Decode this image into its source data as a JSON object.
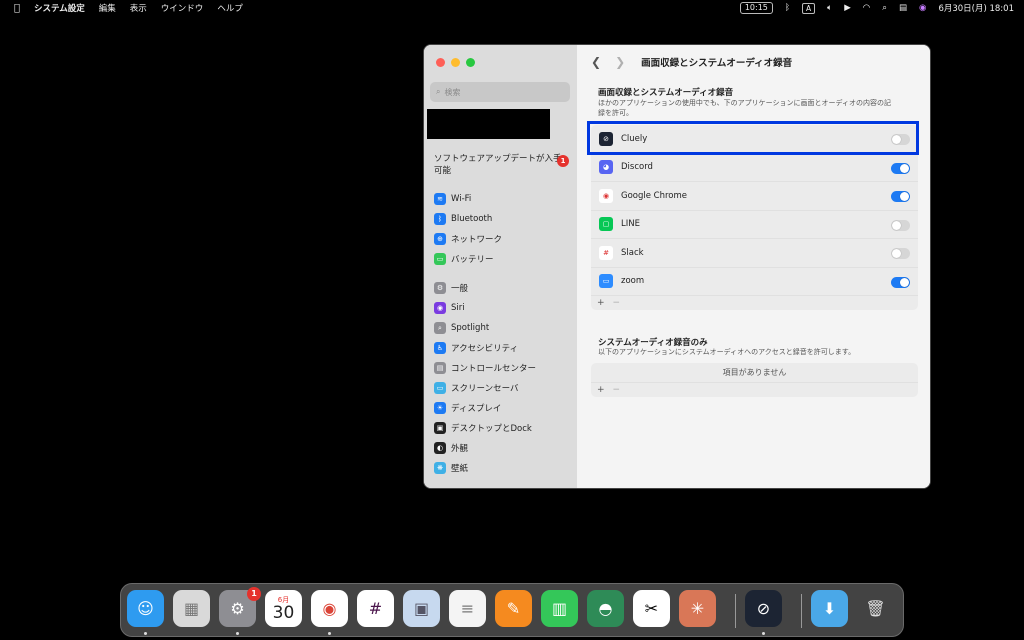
{
  "menubar": {
    "app": "システム設定",
    "menus": [
      "編集",
      "表示",
      "ウインドウ",
      "ヘルプ"
    ],
    "clock_badge": "10:15",
    "input_source": "A",
    "datetime": "6月30日(月) 18:01"
  },
  "sidebar": {
    "search_placeholder": "検索",
    "update_label": "ソフトウェアアップデートが入手可能",
    "update_badge": "1",
    "group1": [
      {
        "label": "Wi-Fi",
        "color": "#1d7af3",
        "glyph": "≋"
      },
      {
        "label": "Bluetooth",
        "color": "#1d7af3",
        "glyph": "ᛒ"
      },
      {
        "label": "ネットワーク",
        "color": "#1d7af3",
        "glyph": "⊕"
      },
      {
        "label": "バッテリー",
        "color": "#34c759",
        "glyph": "▭"
      }
    ],
    "group2": [
      {
        "label": "一般",
        "color": "#8e8e93",
        "glyph": "⚙"
      },
      {
        "label": "Siri",
        "color": "#7a3be0",
        "glyph": "◉"
      },
      {
        "label": "Spotlight",
        "color": "#8e8e93",
        "glyph": "⌕"
      },
      {
        "label": "アクセシビリティ",
        "color": "#1d7af3",
        "glyph": "♿"
      },
      {
        "label": "コントロールセンター",
        "color": "#8e8e93",
        "glyph": "▤"
      },
      {
        "label": "スクリーンセーバ",
        "color": "#3fb0e6",
        "glyph": "▭"
      },
      {
        "label": "ディスプレイ",
        "color": "#1d7af3",
        "glyph": "☀"
      },
      {
        "label": "デスクトップとDock",
        "color": "#222222",
        "glyph": "▣"
      },
      {
        "label": "外観",
        "color": "#222222",
        "glyph": "◐"
      },
      {
        "label": "壁紙",
        "color": "#3fb0e6",
        "glyph": "❋"
      }
    ]
  },
  "main": {
    "title": "画面収録とシステムオーディオ録音",
    "section1_title": "画面収録とシステムオーディオ録音",
    "section1_desc": "ほかのアプリケーションの使用中でも、下のアプリケーションに画面とオーディオの内容の記録を許可。",
    "apps": [
      {
        "name": "Cluely",
        "enabled": false,
        "color": "#1c2433",
        "glyph": "⊘"
      },
      {
        "name": "Discord",
        "enabled": true,
        "color": "#5865f2",
        "glyph": "◕"
      },
      {
        "name": "Google Chrome",
        "enabled": true,
        "color": "#ffffff",
        "glyph": "◉"
      },
      {
        "name": "LINE",
        "enabled": false,
        "color": "#06c755",
        "glyph": "▢"
      },
      {
        "name": "Slack",
        "enabled": false,
        "color": "#ffffff",
        "glyph": "#"
      },
      {
        "name": "zoom",
        "enabled": true,
        "color": "#2d8cff",
        "glyph": "▭"
      }
    ],
    "add_label": "+",
    "remove_label": "−",
    "section2_title": "システムオーディオ録音のみ",
    "section2_desc": "以下のアプリケーションにシステムオーディオへのアクセスと録音を許可します。",
    "empty_label": "項目がありません"
  },
  "dock": {
    "calendar_month": "6月",
    "calendar_day": "30",
    "settings_badge": "1",
    "items": [
      {
        "name": "finder",
        "color": "#2e9bf0"
      },
      {
        "name": "launchpad",
        "color": "#d9d9d9"
      },
      {
        "name": "system-settings",
        "color": "#8e8e93"
      },
      {
        "name": "calendar",
        "color": "#ffffff"
      },
      {
        "name": "chrome",
        "color": "#ffffff"
      },
      {
        "name": "slack",
        "color": "#ffffff"
      },
      {
        "name": "preview",
        "color": "#c7d9ef"
      },
      {
        "name": "textedit",
        "color": "#f4f4f4"
      },
      {
        "name": "pages",
        "color": "#f58a1f"
      },
      {
        "name": "numbers",
        "color": "#34c759"
      },
      {
        "name": "maps-like",
        "color": "#2e8b57"
      },
      {
        "name": "capcut",
        "color": "#ffffff"
      },
      {
        "name": "claude",
        "color": "#d97757"
      },
      {
        "name": "cluely",
        "color": "#1c2433"
      },
      {
        "name": "downloads",
        "color": "#4aa8e8"
      },
      {
        "name": "trash",
        "color": "#bfbfbf"
      }
    ]
  }
}
